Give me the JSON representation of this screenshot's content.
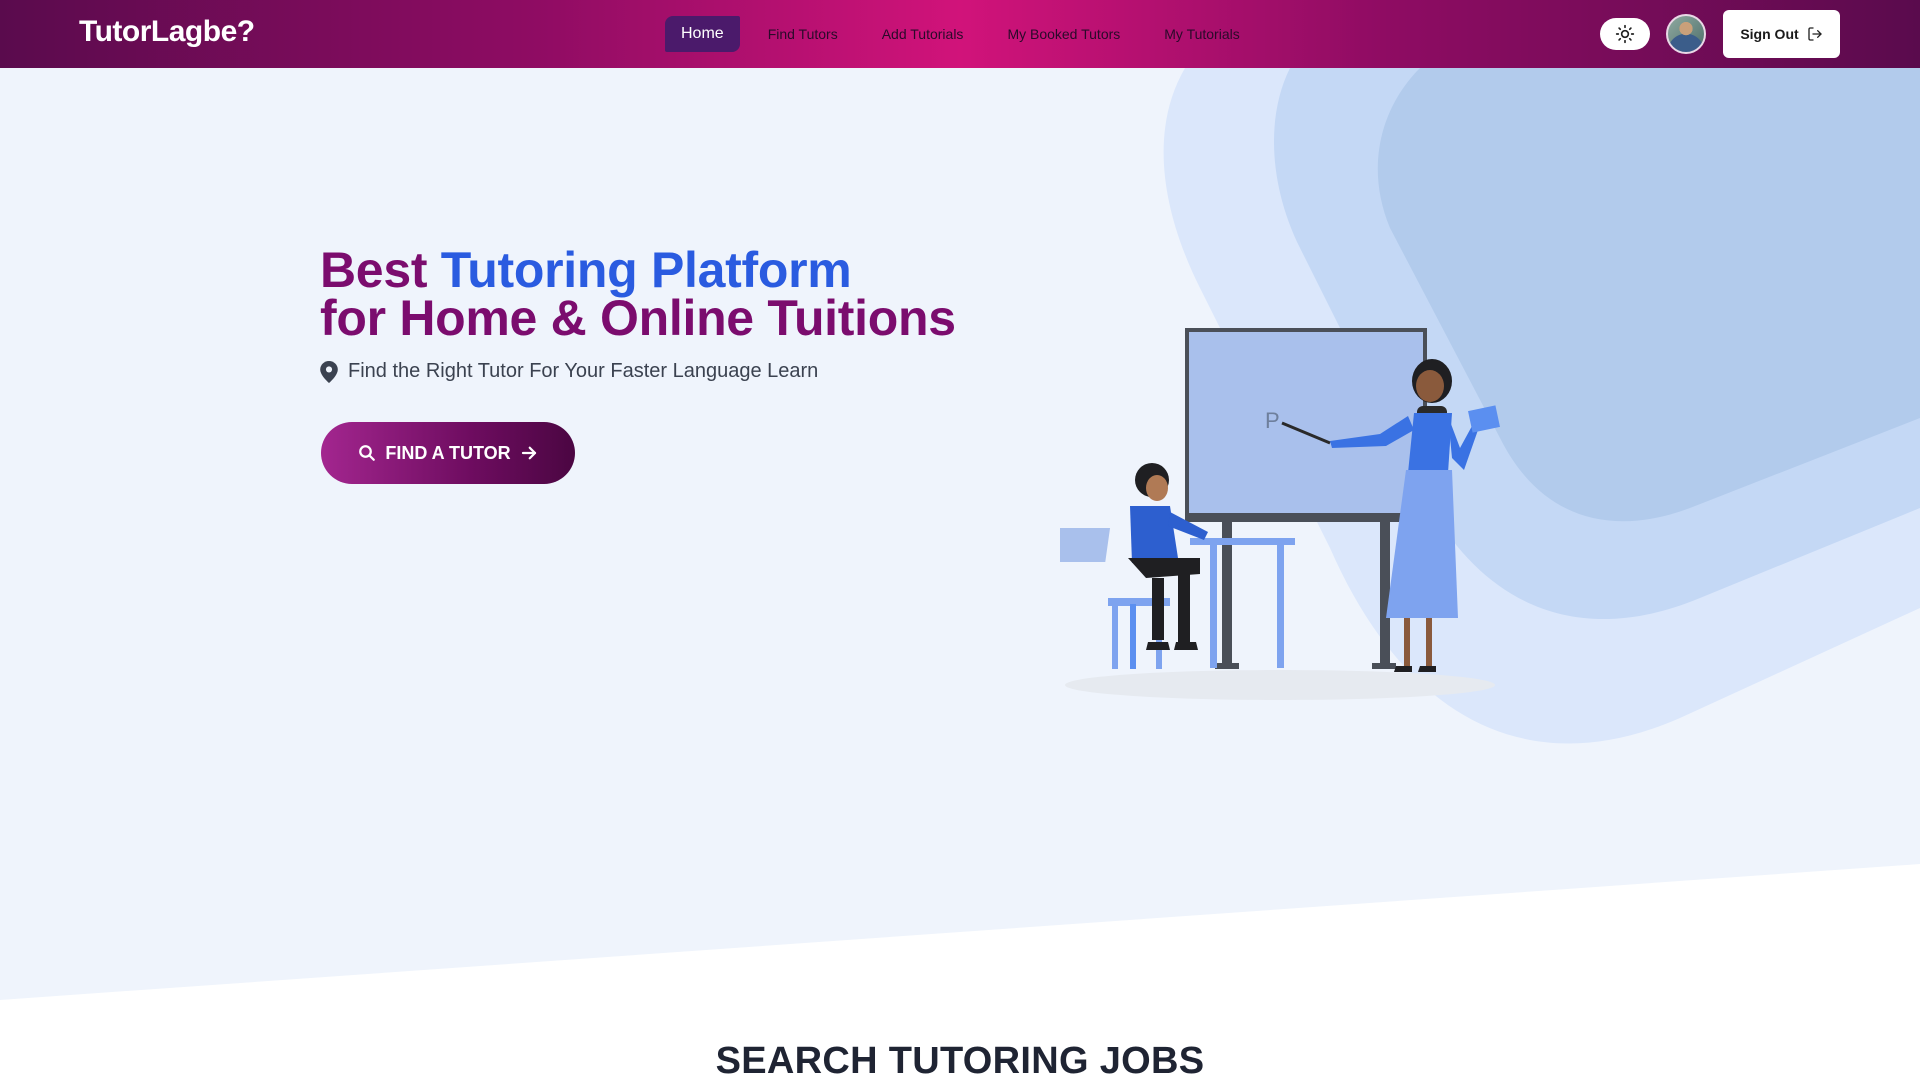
{
  "navbar": {
    "brand": "TutorLagbe?",
    "links": [
      {
        "label": "Home",
        "active": true
      },
      {
        "label": "Find Tutors",
        "active": false
      },
      {
        "label": "Add Tutorials",
        "active": false
      },
      {
        "label": "My Booked Tutors",
        "active": false
      },
      {
        "label": "My Tutorials",
        "active": false
      }
    ],
    "theme_toggle_icon": "sun-icon",
    "signout_label": "Sign Out",
    "signout_icon": "logout-icon"
  },
  "hero": {
    "headline_part1": "Best ",
    "headline_highlight": "Tutoring Platform",
    "headline_line2": "for Home & Online Tuitions",
    "subline": "Find the Right Tutor For Your Faster Language Learn",
    "subline_icon": "map-pin-icon",
    "cta_label": "FIND A TUTOR",
    "cta_icon_left": "search-icon",
    "cta_icon_right": "arrow-right-icon",
    "board_letter": "P"
  },
  "next_section": {
    "title": "SEARCH TUTORING JOBS"
  },
  "colors": {
    "nav_gradient_center": "#d1137a",
    "nav_gradient_edge": "#5a0b4d",
    "headline_purple": "#7b0c6e",
    "headline_blue": "#2a5be0",
    "hero_bg": "#eff4fc"
  }
}
